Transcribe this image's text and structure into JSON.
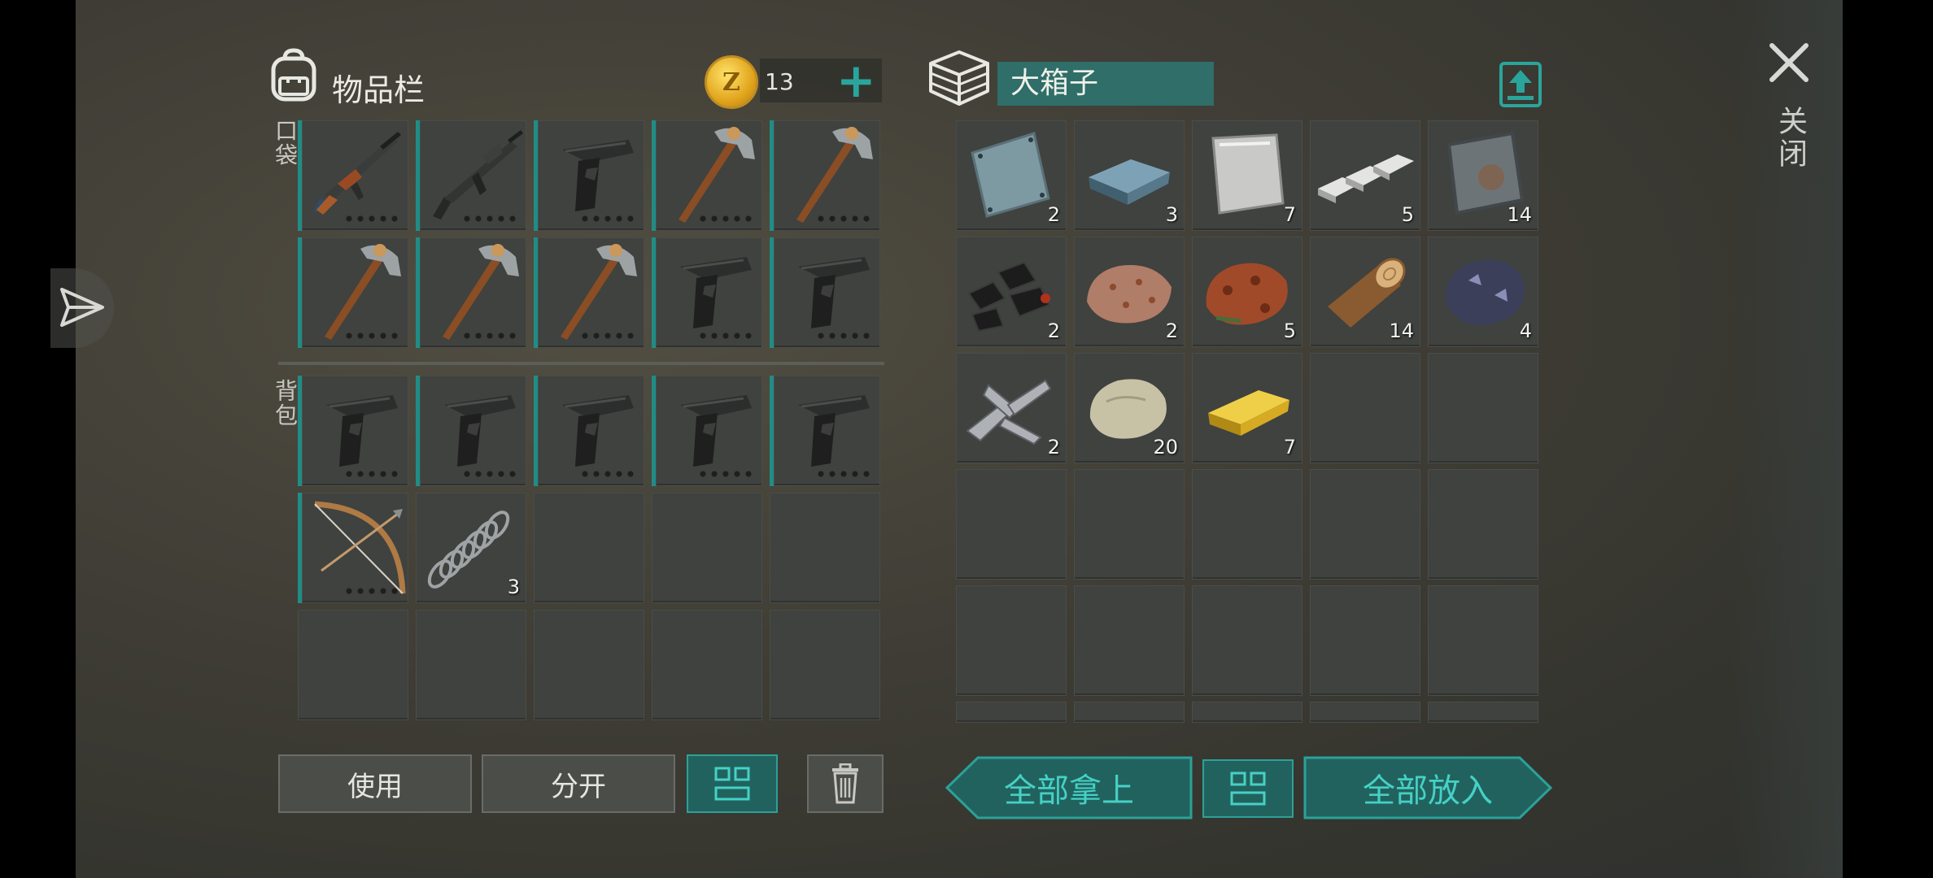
{
  "inventory": {
    "title": "物品栏",
    "coin_symbol": "Z",
    "coin_count": "13",
    "add_symbol": "+",
    "pocket_label": "口袋",
    "backpack_label": "背包",
    "pocket_items": [
      {
        "icon": "ak-rifle-icon"
      },
      {
        "icon": "m16-rifle-icon"
      },
      {
        "icon": "pistol-icon"
      },
      {
        "icon": "pickaxe-icon"
      },
      {
        "icon": "pickaxe-icon"
      },
      {
        "icon": "pickaxe-icon"
      },
      {
        "icon": "pickaxe-icon"
      },
      {
        "icon": "pickaxe-icon"
      },
      {
        "icon": "pistol-icon"
      },
      {
        "icon": "pistol-icon"
      }
    ],
    "backpack_items": [
      {
        "icon": "pistol-icon"
      },
      {
        "icon": "pistol-icon"
      },
      {
        "icon": "pistol-icon"
      },
      {
        "icon": "pistol-icon"
      },
      {
        "icon": "pistol-icon"
      },
      {
        "icon": "bow-icon"
      },
      {
        "icon": "spring-icon",
        "count": "3"
      }
    ],
    "buttons": {
      "use": "使用",
      "split": "分开"
    }
  },
  "container": {
    "name": "大箱子",
    "items": [
      {
        "icon": "metal-sheet-icon",
        "count": "2"
      },
      {
        "icon": "iron-ingot-icon",
        "count": "3"
      },
      {
        "icon": "sheet-metal-icon",
        "count": "7"
      },
      {
        "icon": "aluminum-bars-icon",
        "count": "5"
      },
      {
        "icon": "rusty-plate-icon",
        "count": "14"
      },
      {
        "icon": "coal-icon",
        "count": "2"
      },
      {
        "icon": "copper-ore-icon",
        "count": "2"
      },
      {
        "icon": "iron-ore-icon",
        "count": "5"
      },
      {
        "icon": "wood-log-icon",
        "count": "14"
      },
      {
        "icon": "dark-ore-icon",
        "count": "4"
      },
      {
        "icon": "scrap-metal-icon",
        "count": "2"
      },
      {
        "icon": "stone-icon",
        "count": "20"
      },
      {
        "icon": "gold-bar-icon",
        "count": "7"
      }
    ],
    "buttons": {
      "take_all": "全部拿上",
      "put_all": "全部放入"
    }
  },
  "close_label": "关闭",
  "colors": {
    "accent": "#2aa59c",
    "slot": "#3f423f"
  }
}
